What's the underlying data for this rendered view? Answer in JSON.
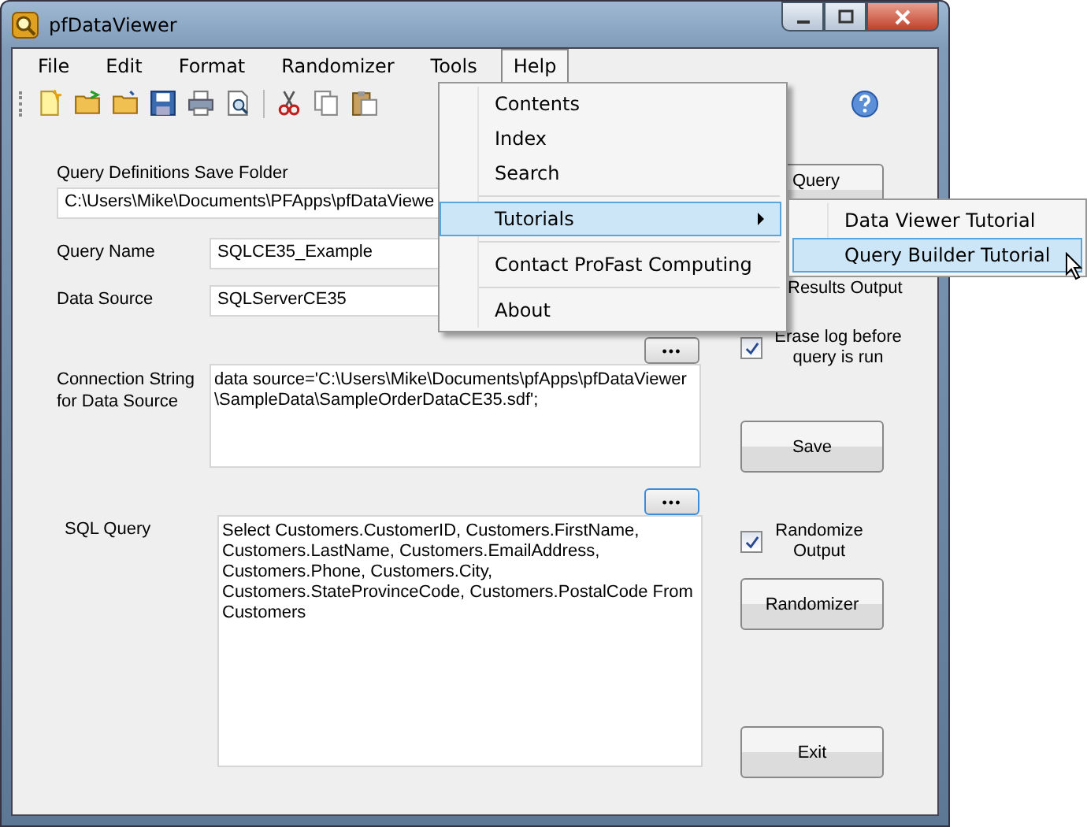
{
  "window": {
    "title": "pfDataViewer"
  },
  "menu_bar": [
    {
      "label": "File",
      "selected": false
    },
    {
      "label": "Edit",
      "selected": false
    },
    {
      "label": "Format",
      "selected": false
    },
    {
      "label": "Randomizer",
      "selected": false
    },
    {
      "label": "Tools",
      "selected": false
    },
    {
      "label": "Help",
      "selected": true
    }
  ],
  "help_menu": [
    {
      "kind": "item",
      "label": "Contents",
      "selected": false
    },
    {
      "kind": "item",
      "label": "Index",
      "selected": false
    },
    {
      "kind": "item",
      "label": "Search",
      "selected": false
    },
    {
      "kind": "separator"
    },
    {
      "kind": "submenu",
      "label": "Tutorials",
      "selected": true
    },
    {
      "kind": "separator"
    },
    {
      "kind": "item",
      "label": "Contact ProFast Computing",
      "selected": false
    },
    {
      "kind": "separator"
    },
    {
      "kind": "item",
      "label": "About",
      "selected": false
    }
  ],
  "tutorials_submenu": [
    {
      "label": "Data Viewer Tutorial",
      "selected": false
    },
    {
      "label": "Query Builder Tutorial",
      "selected": true
    }
  ],
  "form": {
    "save_folder": {
      "label": "Query Definitions Save Folder",
      "value": "C:\\Users\\Mike\\Documents\\PFApps\\pfDataViewe"
    },
    "query_name": {
      "label": "Query Name",
      "value": "SQLCE35_Example"
    },
    "data_source": {
      "label": "Data Source",
      "value": "SQLServerCE35"
    },
    "connection_string": {
      "label": "Connection String for Data Source",
      "value": "data source='C:\\Users\\Mike\\Documents\\pfApps\\pfDataViewer \\SampleData\\SampleOrderDataCE35.sdf';",
      "browse_button": "•••"
    },
    "sql_query": {
      "label": "SQL Query",
      "value": "Select Customers.CustomerID, Customers.FirstName, Customers.LastName, Customers.EmailAddress, Customers.Phone, Customers.City, Customers.StateProvinceCode, Customers.PostalCode From Customers",
      "browse_button": "•••"
    }
  },
  "side": {
    "run_query_button": "Query",
    "results_output": {
      "label": "Results Output"
    },
    "erase_log": {
      "label": "Erase log before query is run",
      "checked": true
    },
    "save_button": "Save",
    "randomize_output": {
      "label": "Randomize Output",
      "checked": true
    },
    "randomizer_button": "Randomizer",
    "exit_button": "Exit"
  }
}
